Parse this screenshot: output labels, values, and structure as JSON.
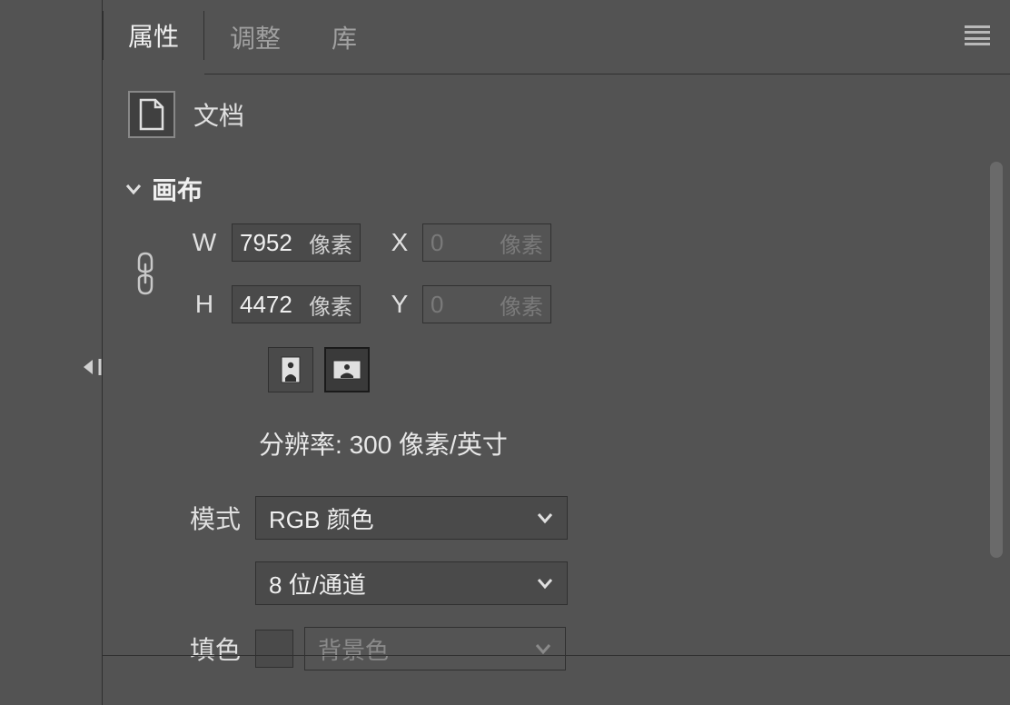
{
  "tabs": {
    "properties": "属性",
    "adjustments": "调整",
    "libraries": "库"
  },
  "document": {
    "label": "文档"
  },
  "canvas": {
    "section_label": "画布",
    "w_label": "W",
    "h_label": "H",
    "x_label": "X",
    "y_label": "Y",
    "width_value": "7952",
    "height_value": "4472",
    "x_value": "0",
    "y_value": "0",
    "unit": "像素",
    "resolution_label": "分辨率:",
    "resolution_value": "300 像素/英寸",
    "mode_label": "模式",
    "mode_value": "RGB 颜色",
    "depth_value": "8 位/通道",
    "fill_label": "填色",
    "fill_value": "背景色"
  }
}
